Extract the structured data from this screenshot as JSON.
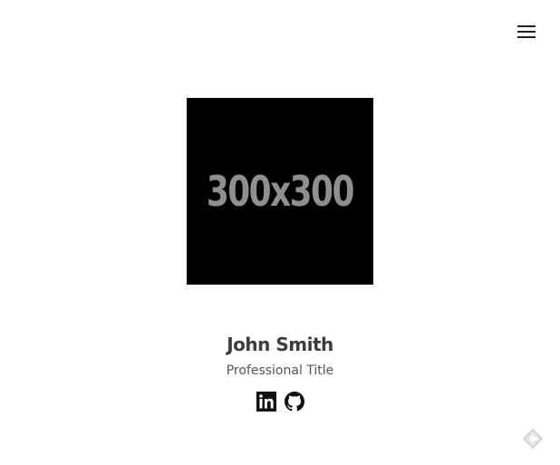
{
  "header": {
    "menu_icon": "hamburger-menu-icon"
  },
  "profile": {
    "image_text": "300x300",
    "name": "John Smith",
    "title": "Professional Title"
  },
  "social": {
    "links": [
      {
        "icon": "linkedin-icon"
      },
      {
        "icon": "github-icon"
      }
    ]
  },
  "corner_widget": {
    "icon": "feedback-icon"
  }
}
